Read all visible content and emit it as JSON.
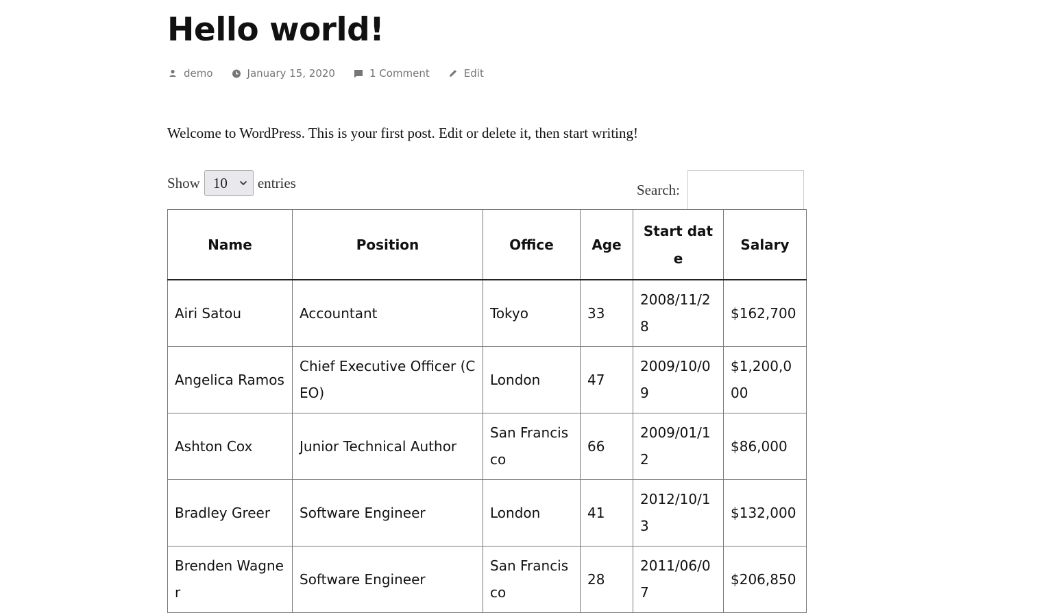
{
  "post": {
    "title": "Hello world!",
    "meta": {
      "author": "demo",
      "date": "January 15, 2020",
      "comments": "1 Comment",
      "edit": "Edit"
    },
    "intro": "Welcome to WordPress. This is your first post. Edit or delete it, then start writing!"
  },
  "datatable": {
    "length_prefix": "Show",
    "length_value": "10",
    "length_suffix": "entries",
    "search_label": "Search:",
    "search_value": "",
    "columns": [
      "Name",
      "Position",
      "Office",
      "Age",
      "Start date",
      "Salary"
    ],
    "rows": [
      [
        "Airi Satou",
        "Accountant",
        "Tokyo",
        "33",
        "2008/11/28",
        "$162,700"
      ],
      [
        "Angelica Ramos",
        "Chief Executive Officer (CEO)",
        "London",
        "47",
        "2009/10/09",
        "$1,200,000"
      ],
      [
        "Ashton Cox",
        "Junior Technical Author",
        "San Francisco",
        "66",
        "2009/01/12",
        "$86,000"
      ],
      [
        "Bradley Greer",
        "Software Engineer",
        "London",
        "41",
        "2012/10/13",
        "$132,000"
      ],
      [
        "Brenden Wagner",
        "Software Engineer",
        "San Francisco",
        "28",
        "2011/06/07",
        "$206,850"
      ]
    ]
  },
  "icons": {
    "author": "person-icon",
    "date": "clock-icon",
    "comments": "comment-icon",
    "edit": "pencil-icon"
  }
}
